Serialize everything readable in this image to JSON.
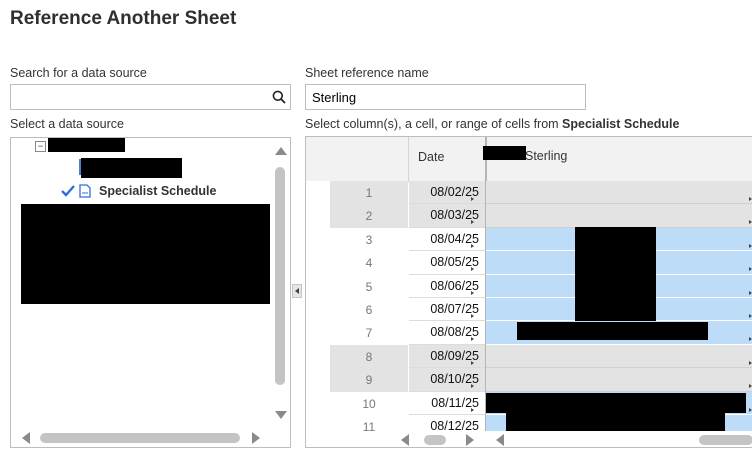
{
  "title": "Reference Another Sheet",
  "search": {
    "label": "Search for a data source",
    "value": "",
    "placeholder": ""
  },
  "sheet_ref": {
    "label": "Sheet reference name",
    "value": "Sterling"
  },
  "select_source_label": "Select a data source",
  "tree": {
    "selected_item": "Specialist Schedule",
    "collapse_symbol": "−"
  },
  "grid": {
    "instruction_prefix": "Select column(s), a cell, or range of cells from ",
    "sheet_name": "Specialist Schedule",
    "columns": [
      "Date",
      "Sterling"
    ],
    "rows": [
      {
        "num": "1",
        "date": "08/02/25",
        "shade": "gray"
      },
      {
        "num": "2",
        "date": "08/03/25",
        "shade": "gray"
      },
      {
        "num": "3",
        "date": "08/04/25",
        "shade": "blue"
      },
      {
        "num": "4",
        "date": "08/05/25",
        "shade": "blue"
      },
      {
        "num": "5",
        "date": "08/06/25",
        "shade": "blue"
      },
      {
        "num": "6",
        "date": "08/07/25",
        "shade": "blue"
      },
      {
        "num": "7",
        "date": "08/08/25",
        "shade": "blue"
      },
      {
        "num": "8",
        "date": "08/09/25",
        "shade": "gray"
      },
      {
        "num": "9",
        "date": "08/10/25",
        "shade": "gray"
      },
      {
        "num": "10",
        "date": "08/11/25",
        "shade": "blue"
      },
      {
        "num": "11",
        "date": "08/12/25",
        "shade": "blue"
      }
    ]
  },
  "colors": {
    "selected_blue": "#bcdcf7",
    "weekend_gray": "#e3e3e3",
    "check_blue": "#2d6fd6"
  }
}
